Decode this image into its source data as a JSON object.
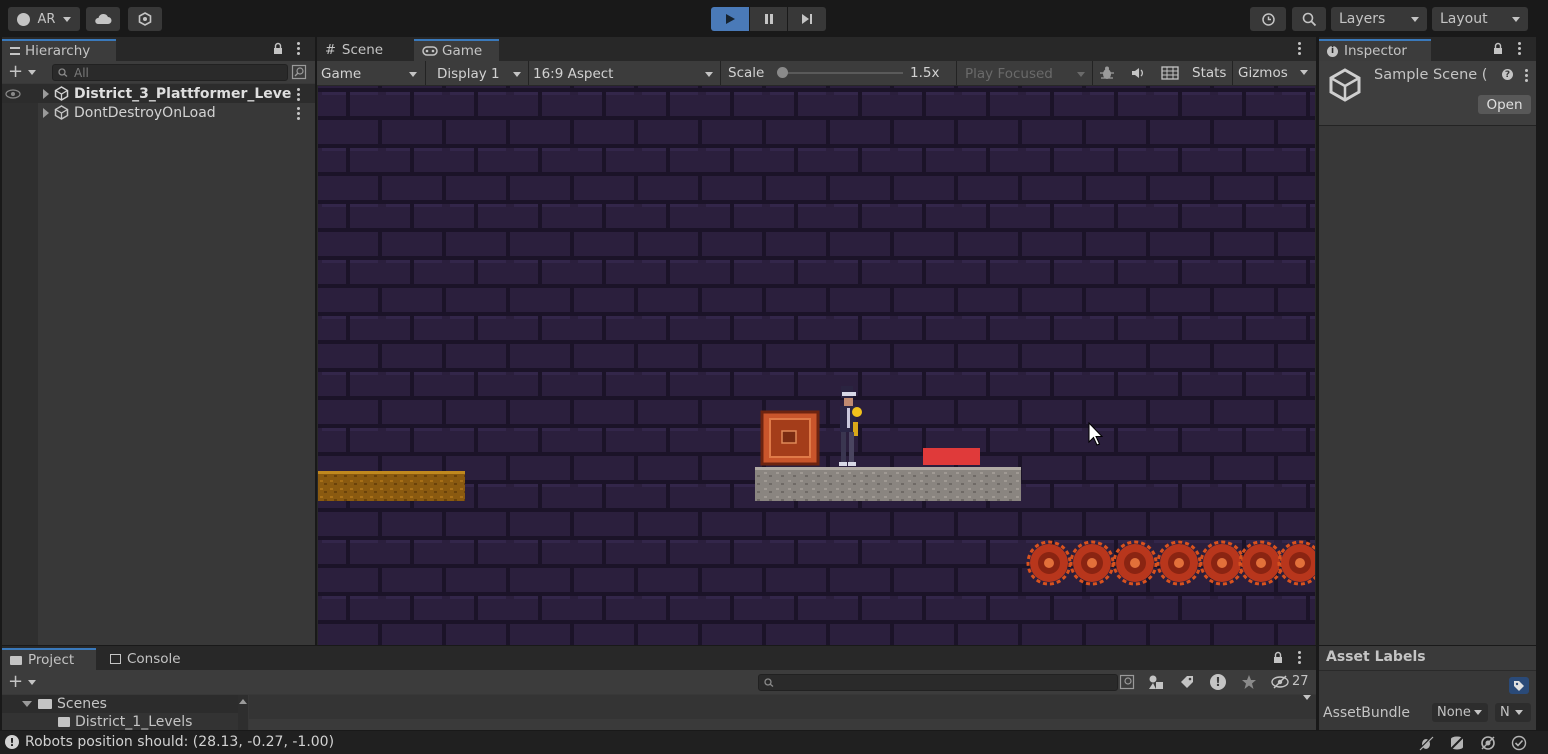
{
  "toolbar": {
    "account_label": "AR",
    "layers_label": "Layers",
    "layout_label": "Layout"
  },
  "hierarchy": {
    "tab_label": "Hierarchy",
    "search_placeholder": "All",
    "items": [
      {
        "label": "District_3_Plattformer_Leve"
      },
      {
        "label": "DontDestroyOnLoad"
      }
    ]
  },
  "game_view": {
    "tabs": [
      {
        "label": "Scene"
      },
      {
        "label": "Game"
      }
    ],
    "view_select": "Game",
    "display_select": "Display 1",
    "aspect_select": "16:9 Aspect",
    "scale_label": "Scale",
    "scale_value": "1.5x",
    "scale_level": 0.0,
    "play_mode_select": "Play Focused",
    "stats_label": "Stats",
    "gizmos_label": "Gizmos"
  },
  "inspector": {
    "tab_label": "Inspector",
    "asset_name": "Sample Scene (",
    "open_label": "Open",
    "asset_labels_title": "Asset Labels",
    "asset_bundle_label": "AssetBundle",
    "asset_bundle_value": "None",
    "asset_variant_value": "N"
  },
  "project": {
    "tabs": [
      {
        "label": "Project"
      },
      {
        "label": "Console"
      }
    ],
    "tree": [
      {
        "label": "Scenes"
      },
      {
        "label": "District_1_Levels"
      }
    ],
    "hidden_count": "27"
  },
  "status_bar": {
    "message": "Robots position should: (28.13, -0.27, -1.00)"
  },
  "colors": {
    "accent": "#3a79bb",
    "wall": "#2b1f3d",
    "mortar": "#1b1328",
    "crate": "#c9552b",
    "marker": "#e03a3a"
  }
}
